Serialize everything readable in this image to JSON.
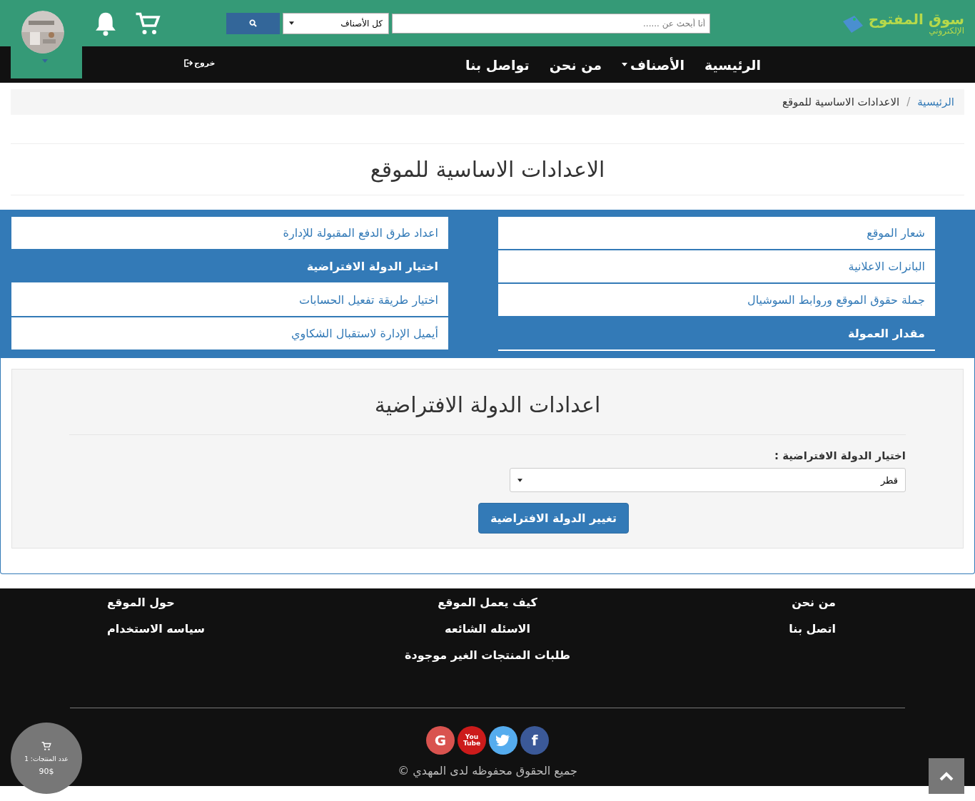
{
  "header": {
    "logo": {
      "title": "سوق المفتوح",
      "subtitle": "الإلكتروني"
    },
    "search": {
      "placeholder": "أنا أبحث عن ......"
    },
    "category_select": {
      "value": "كل الأصناف"
    }
  },
  "nav": {
    "items": [
      {
        "label": "الرئيسية",
        "has_dropdown": false
      },
      {
        "label": "الأصناف",
        "has_dropdown": true
      },
      {
        "label": "من نحن",
        "has_dropdown": false
      },
      {
        "label": "تواصل بنا",
        "has_dropdown": false
      }
    ],
    "logout": "خروج"
  },
  "breadcrumb": [
    {
      "label": "الرئيسية",
      "kind": "link"
    },
    {
      "label": "/",
      "kind": "separator"
    },
    {
      "label": "الاعدادات الاساسية للموقع",
      "kind": "current"
    }
  ],
  "page_title": "الاعدادات الاساسية للموقع",
  "settings_menu": [
    {
      "label": "شعار الموقع",
      "selected": false
    },
    {
      "label": "اعداد طرق الدفع المقبولة للإدارة",
      "selected": false
    },
    {
      "label": "البانرات الاعلانية",
      "selected": false
    },
    {
      "label": "اختيار الدولة الافتراضية",
      "selected": true
    },
    {
      "label": "جملة حقوق الموقع وروابط السوشيال",
      "selected": false
    },
    {
      "label": "اختيار طريقة تفعيل الحسابات",
      "selected": false
    },
    {
      "label": "مقدار العمولة",
      "selected": true
    },
    {
      "label": "أيميل الإدارة لاستقبال الشكاوي",
      "selected": false
    }
  ],
  "form": {
    "title": "اعدادات الدولة الافتراضية",
    "field_label": "اختيار الدولة الافتراضية :",
    "country_select": {
      "value": "قطر"
    },
    "submit": "تغيير الدولة الافتراضية"
  },
  "footer": {
    "columns": [
      {
        "links": [
          "من نحن",
          "اتصل بنا"
        ]
      },
      {
        "links": [
          "كيف يعمل الموقع",
          "الاسئله الشائعه",
          "طلبات المنتجات الغير موجودة"
        ]
      },
      {
        "links": [
          "حول الموقع",
          "سياسه الاستخدام"
        ]
      }
    ],
    "social": [
      {
        "kind": "facebook",
        "label": "f"
      },
      {
        "kind": "twitter"
      },
      {
        "kind": "youtube",
        "label": "You Tube"
      },
      {
        "kind": "google",
        "label": "G"
      }
    ],
    "copyright": "جميع الحقوق محفوظه لدى المهدي ©"
  },
  "cart_summary": {
    "count_label": "عدد المنتجات: 1",
    "total": "90$"
  }
}
